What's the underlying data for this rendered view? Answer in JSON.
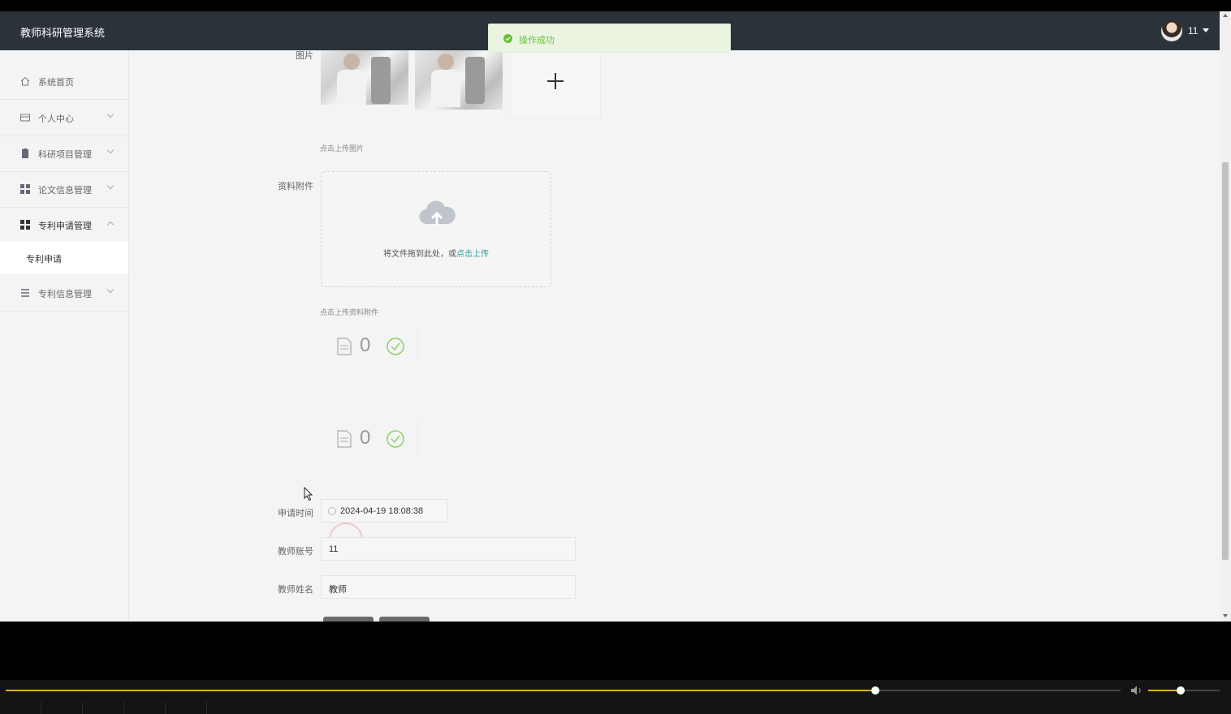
{
  "header": {
    "app_title": "教师科研管理系统",
    "user": "11"
  },
  "toast": {
    "message": "操作成功"
  },
  "sidebar": {
    "items": [
      {
        "label": "系统首页",
        "icon": "home-icon"
      },
      {
        "label": "个人中心",
        "icon": "card-icon"
      },
      {
        "label": "科研项目管理",
        "icon": "clipboard-icon"
      },
      {
        "label": "论文信息管理",
        "icon": "grid-icon"
      },
      {
        "label": "专利申请管理",
        "icon": "grid-icon"
      },
      {
        "label": "专利信息管理",
        "icon": "list-icon"
      }
    ],
    "active_sub": "专利申请"
  },
  "form": {
    "image_label": "图片",
    "image_hint": "点击上传图片",
    "attachment_label": "资料附件",
    "drop_text": "将文件拖到此处，或",
    "drop_link": "点击上传",
    "attachment_hint": "点击上传资料附件",
    "files": [
      {
        "count": "0"
      },
      {
        "count": "0"
      }
    ],
    "apply_time_label": "申请时间",
    "apply_time_value": "2024-04-19 18:08:38",
    "teacher_account_label": "教师账号",
    "teacher_account_value": "11",
    "teacher_name_label": "教师姓名",
    "teacher_name_value": "教师"
  },
  "player": {
    "progress": 0.78,
    "volume": 0.45
  },
  "colors": {
    "accent": "#d8b021",
    "link": "#2d9aa4",
    "success": "#67c23a",
    "topbar": "#2c3239"
  }
}
